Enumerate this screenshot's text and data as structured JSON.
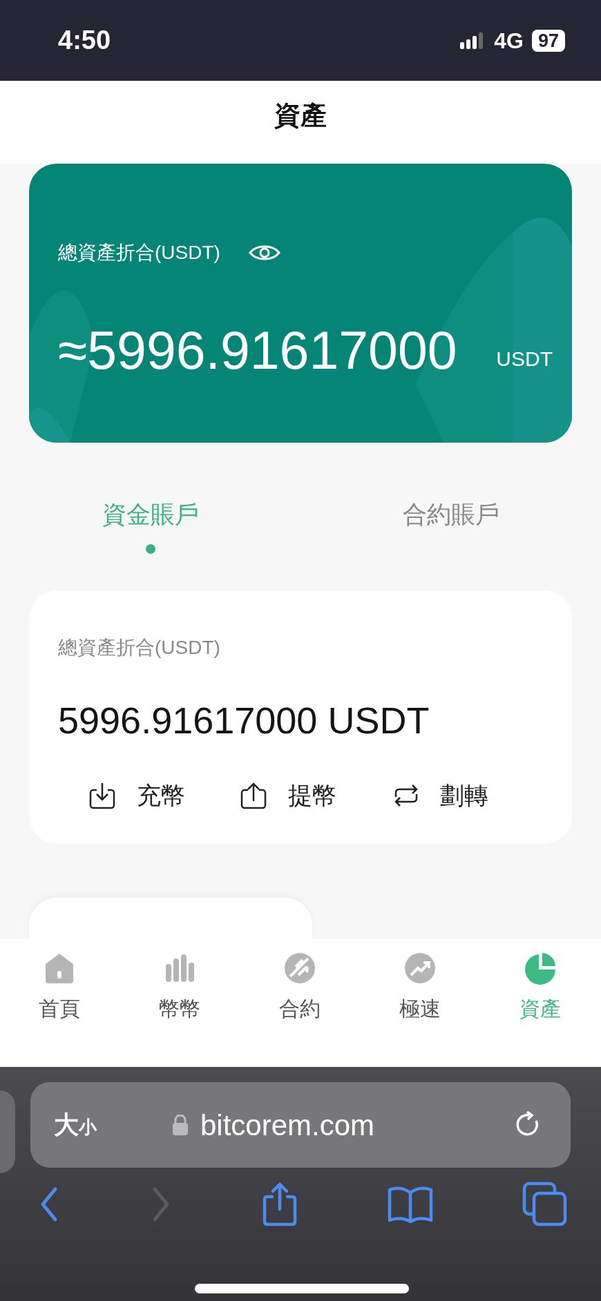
{
  "status_bar": {
    "time": "4:50",
    "network": "4G",
    "battery": "97"
  },
  "header": {
    "title": "資產"
  },
  "summary_card": {
    "label": "總資產折合(USDT)",
    "amount": "≈5996.91617000",
    "unit": "USDT"
  },
  "tabs": [
    {
      "label": "資金賬戶",
      "selected": true
    },
    {
      "label": "合約賬戶",
      "selected": false
    }
  ],
  "account_card": {
    "label": "總資產折合(USDT)",
    "amount": "5996.91617000 USDT",
    "actions": [
      {
        "kind": "deposit",
        "label": "充幣"
      },
      {
        "kind": "withdraw",
        "label": "提幣"
      },
      {
        "kind": "transfer",
        "label": "劃轉"
      }
    ]
  },
  "bottom_nav": [
    {
      "kind": "home",
      "label": "首頁",
      "selected": false
    },
    {
      "kind": "spot",
      "label": "幣幣",
      "selected": false
    },
    {
      "kind": "contract",
      "label": "合約",
      "selected": false
    },
    {
      "kind": "speed",
      "label": "極速",
      "selected": false
    },
    {
      "kind": "assets",
      "label": "資產",
      "selected": true
    }
  ],
  "browser": {
    "text_size_big": "大",
    "text_size_small": "小",
    "url": "bitcorem.com",
    "forward_disabled": true
  }
}
